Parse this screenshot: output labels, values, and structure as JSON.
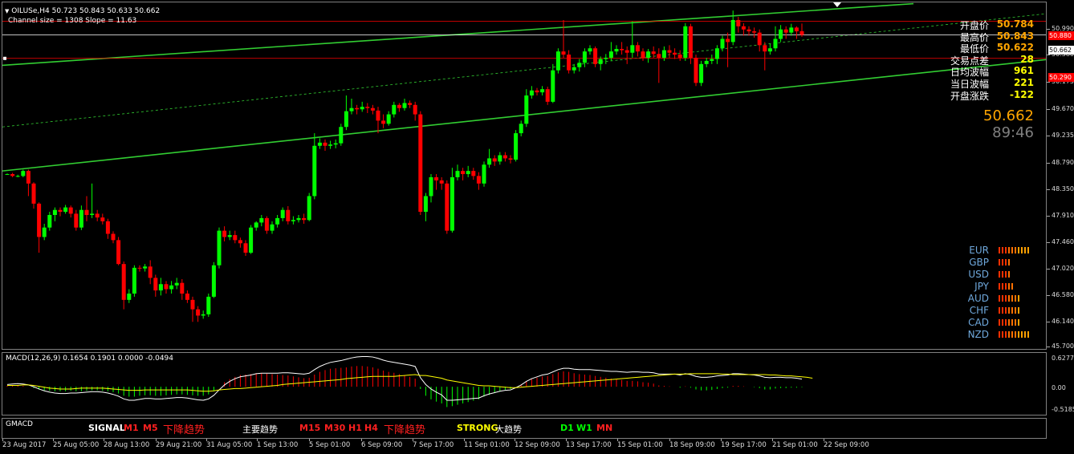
{
  "header": {
    "symbol_line": "OILUSe,H4  50.723 50.843 50.633 50.662",
    "channel_line": "Channel size = 1308 Slope = 11.63"
  },
  "info_panel": {
    "rows": [
      {
        "label": "开盘价",
        "value": "50.784",
        "color": "#ffa500"
      },
      {
        "label": "最高价",
        "value": "50.843",
        "color": "#ffa500"
      },
      {
        "label": "最低价",
        "value": "50.622",
        "color": "#ffa500"
      },
      {
        "label": "交易点差",
        "value": "28",
        "color": "#ffff00"
      },
      {
        "label": "日均波幅",
        "value": "961",
        "color": "#ffff00"
      },
      {
        "label": "当日波幅",
        "value": "221",
        "color": "#ffff00"
      },
      {
        "label": "开盘涨跌",
        "value": "-122",
        "color": "#ffff00"
      }
    ],
    "price_big": "50.662",
    "timer": "89:46"
  },
  "currency_strength": [
    {
      "name": "EUR",
      "bars": 10
    },
    {
      "name": "GBP",
      "bars": 4
    },
    {
      "name": "USD",
      "bars": 4
    },
    {
      "name": "JPY",
      "bars": 5
    },
    {
      "name": "AUD",
      "bars": 7
    },
    {
      "name": "CHF",
      "bars": 7
    },
    {
      "name": "CAD",
      "bars": 7
    },
    {
      "name": "NZD",
      "bars": 10
    }
  ],
  "y_axis": [
    "50.990",
    "50.580",
    "50.175",
    "49.670",
    "49.235",
    "48.790",
    "48.350",
    "47.910",
    "47.460",
    "47.020",
    "46.580",
    "46.140",
    "45.700"
  ],
  "price_tags": [
    {
      "label": "50.880",
      "bg": "#ff0000",
      "fg": "#fff"
    },
    {
      "label": "50.662",
      "bg": "#ffffff",
      "fg": "#000"
    },
    {
      "label": "50.290",
      "bg": "#ff0000",
      "fg": "#fff"
    }
  ],
  "macd": {
    "title": "MACD(12,26,9) 0.1654 0.1901 0.0000 -0.0494",
    "y_axis": [
      "0.6277",
      "0.00",
      "-0.5185"
    ]
  },
  "gmacd": {
    "title": "GMACD",
    "signal_label": "SIGNAL",
    "m1": "M1",
    "m5": "M5",
    "trend_short": "下降趋势",
    "main_trend": "主要趋势",
    "m15": "M15",
    "m30": "M30",
    "h1": "H1",
    "h4": "H4",
    "trend_mid": "下降趋势",
    "strong": "STRONG",
    "big_trend": "大趋势",
    "d1": "D1",
    "w1": "W1",
    "mn": "MN"
  },
  "x_axis": [
    "23 Aug 2017",
    "25 Aug 05:00",
    "28 Aug 13:00",
    "29 Aug 21:00",
    "31 Aug 05:00",
    "1 Sep 13:00",
    "5 Sep 01:00",
    "6 Sep 09:00",
    "7 Sep 17:00",
    "11 Sep 01:00",
    "12 Sep 09:00",
    "13 Sep 17:00",
    "15 Sep 01:00",
    "18 Sep 09:00",
    "19 Sep 17:00",
    "21 Sep 01:00",
    "22 Sep 09:00"
  ],
  "colors": {
    "bull": "#00ff00",
    "bear": "#ff0000",
    "channel": "#32cd32",
    "hist_pos": "#ff0000",
    "hist_neg": "#00ff00",
    "macd_main": "#ffffff",
    "macd_signal": "#ffff00"
  },
  "candles": [
    [
      48.45,
      48.45,
      48.44,
      48.46
    ],
    [
      48.45,
      48.42,
      48.4,
      48.47
    ],
    [
      48.42,
      48.42,
      48.4,
      48.44
    ],
    [
      48.42,
      48.5,
      48.4,
      48.52
    ],
    [
      48.5,
      48.3,
      48.1,
      48.52
    ],
    [
      48.3,
      47.98,
      47.9,
      48.32
    ],
    [
      47.98,
      47.45,
      47.2,
      48.0
    ],
    [
      47.45,
      47.6,
      47.4,
      47.66
    ],
    [
      47.6,
      47.8,
      47.55,
      47.85
    ],
    [
      47.8,
      47.88,
      47.7,
      47.92
    ],
    [
      47.88,
      47.85,
      47.78,
      47.92
    ],
    [
      47.85,
      47.92,
      47.82,
      47.96
    ],
    [
      47.92,
      47.82,
      47.76,
      47.95
    ],
    [
      47.82,
      47.6,
      47.55,
      47.88
    ],
    [
      47.6,
      47.88,
      47.56,
      47.95
    ],
    [
      47.88,
      47.8,
      47.7,
      48.1
    ],
    [
      47.8,
      47.82,
      47.75,
      48.3
    ],
    [
      47.82,
      47.76,
      47.7,
      47.88
    ],
    [
      47.76,
      47.7,
      47.65,
      47.82
    ],
    [
      47.7,
      47.5,
      47.42,
      47.74
    ],
    [
      47.5,
      47.4,
      47.35,
      47.54
    ],
    [
      47.4,
      47.02,
      47.0,
      47.45
    ],
    [
      47.02,
      46.45,
      46.3,
      47.06
    ],
    [
      46.45,
      46.55,
      46.4,
      46.62
    ],
    [
      46.55,
      46.96,
      46.5,
      47.0
    ],
    [
      46.96,
      46.95,
      46.9,
      47.0
    ],
    [
      46.95,
      46.98,
      46.9,
      47.02
    ],
    [
      46.98,
      46.8,
      46.7,
      47.08
    ],
    [
      46.8,
      46.6,
      46.5,
      46.85
    ],
    [
      46.6,
      46.7,
      46.52,
      46.8
    ],
    [
      46.7,
      46.62,
      46.55,
      46.75
    ],
    [
      46.62,
      46.68,
      46.55,
      46.75
    ],
    [
      46.68,
      46.72,
      46.62,
      46.8
    ],
    [
      46.72,
      46.55,
      46.45,
      46.78
    ],
    [
      46.55,
      46.45,
      46.4,
      46.6
    ],
    [
      46.45,
      46.3,
      46.1,
      46.5
    ],
    [
      46.3,
      46.2,
      46.1,
      46.35
    ],
    [
      46.2,
      46.22,
      46.15,
      46.28
    ],
    [
      46.22,
      46.5,
      46.18,
      46.55
    ],
    [
      46.5,
      47.0,
      46.48,
      47.05
    ],
    [
      47.0,
      47.55,
      46.95,
      47.6
    ],
    [
      47.55,
      47.45,
      47.38,
      47.62
    ],
    [
      47.45,
      47.48,
      47.4,
      47.55
    ],
    [
      47.48,
      47.4,
      47.35,
      47.55
    ],
    [
      47.4,
      47.35,
      47.28,
      47.44
    ],
    [
      47.35,
      47.2,
      47.15,
      47.4
    ],
    [
      47.2,
      47.6,
      47.18,
      47.64
    ],
    [
      47.6,
      47.68,
      47.55,
      47.7
    ],
    [
      47.68,
      47.75,
      47.62,
      47.8
    ],
    [
      47.75,
      47.55,
      47.5,
      47.78
    ],
    [
      47.55,
      47.65,
      47.5,
      47.7
    ],
    [
      47.65,
      47.75,
      47.6,
      47.8
    ],
    [
      47.75,
      47.88,
      47.7,
      47.92
    ],
    [
      47.88,
      47.7,
      47.65,
      47.94
    ],
    [
      47.7,
      47.72,
      47.65,
      47.78
    ],
    [
      47.72,
      47.75,
      47.68,
      47.8
    ],
    [
      47.75,
      47.72,
      47.66,
      47.82
    ],
    [
      47.72,
      48.1,
      47.7,
      48.15
    ],
    [
      48.1,
      48.9,
      48.05,
      49.1
    ],
    [
      48.9,
      48.95,
      48.85,
      49.02
    ],
    [
      48.95,
      48.9,
      48.82,
      49.0
    ],
    [
      48.9,
      48.92,
      48.85,
      48.98
    ],
    [
      48.92,
      48.94,
      48.86,
      49.0
    ],
    [
      48.94,
      49.2,
      48.9,
      49.25
    ],
    [
      49.2,
      49.45,
      49.15,
      49.7
    ],
    [
      49.45,
      49.5,
      49.4,
      49.65
    ],
    [
      49.5,
      49.48,
      49.4,
      49.55
    ],
    [
      49.48,
      49.52,
      49.44,
      49.6
    ],
    [
      49.52,
      49.5,
      49.42,
      49.58
    ],
    [
      49.5,
      49.46,
      49.4,
      49.55
    ],
    [
      49.46,
      49.3,
      49.1,
      49.52
    ],
    [
      49.3,
      49.25,
      49.18,
      49.4
    ],
    [
      49.25,
      49.4,
      49.22,
      49.45
    ],
    [
      49.4,
      49.55,
      49.35,
      49.6
    ],
    [
      49.55,
      49.5,
      49.44,
      49.58
    ],
    [
      49.5,
      49.58,
      49.46,
      49.65
    ],
    [
      49.58,
      49.55,
      49.5,
      49.62
    ],
    [
      49.55,
      49.4,
      49.3,
      49.6
    ],
    [
      49.4,
      47.85,
      47.8,
      49.45
    ],
    [
      47.85,
      48.1,
      47.7,
      48.15
    ],
    [
      48.1,
      48.4,
      48.0,
      48.45
    ],
    [
      48.4,
      48.35,
      48.2,
      48.45
    ],
    [
      48.35,
      48.3,
      48.2,
      48.4
    ],
    [
      48.3,
      47.55,
      47.5,
      48.35
    ],
    [
      47.55,
      48.4,
      47.52,
      48.55
    ],
    [
      48.4,
      48.5,
      48.35,
      48.6
    ],
    [
      48.5,
      48.45,
      48.35,
      48.55
    ],
    [
      48.45,
      48.5,
      48.4,
      48.58
    ],
    [
      48.5,
      48.42,
      48.36,
      48.55
    ],
    [
      48.42,
      48.3,
      48.2,
      48.48
    ],
    [
      48.3,
      48.6,
      48.25,
      48.65
    ],
    [
      48.6,
      48.7,
      48.55,
      48.85
    ],
    [
      48.7,
      48.65,
      48.58,
      48.75
    ],
    [
      48.65,
      48.75,
      48.6,
      48.8
    ],
    [
      48.75,
      48.7,
      48.65,
      48.8
    ],
    [
      48.7,
      48.68,
      48.62,
      48.75
    ],
    [
      48.68,
      49.1,
      48.65,
      49.15
    ],
    [
      49.1,
      49.25,
      49.05,
      49.3
    ],
    [
      49.25,
      49.7,
      49.2,
      49.8
    ],
    [
      49.7,
      49.78,
      49.65,
      49.85
    ],
    [
      49.78,
      49.75,
      49.7,
      49.82
    ],
    [
      49.75,
      49.8,
      49.7,
      49.85
    ],
    [
      49.8,
      49.6,
      49.55,
      49.84
    ],
    [
      49.6,
      50.1,
      49.58,
      50.2
    ],
    [
      50.1,
      50.4,
      50.05,
      50.45
    ],
    [
      50.4,
      50.35,
      50.3,
      50.9
    ],
    [
      50.35,
      50.1,
      50.05,
      50.42
    ],
    [
      50.1,
      50.15,
      50.05,
      50.2
    ],
    [
      50.15,
      50.22,
      50.08,
      50.28
    ],
    [
      50.22,
      50.4,
      50.15,
      50.45
    ],
    [
      50.4,
      50.45,
      50.35,
      50.5
    ],
    [
      50.45,
      50.2,
      50.15,
      50.48
    ],
    [
      50.2,
      50.28,
      50.1,
      50.32
    ],
    [
      50.28,
      50.3,
      50.2,
      50.36
    ],
    [
      50.3,
      50.4,
      50.25,
      50.55
    ],
    [
      50.4,
      50.44,
      50.35,
      50.5
    ],
    [
      50.44,
      50.42,
      50.35,
      50.55
    ],
    [
      50.42,
      50.38,
      50.2,
      50.48
    ],
    [
      50.38,
      50.5,
      50.3,
      50.88
    ],
    [
      50.5,
      50.4,
      50.32,
      50.55
    ],
    [
      50.4,
      50.3,
      50.25,
      50.45
    ],
    [
      50.3,
      50.4,
      50.22,
      50.44
    ],
    [
      50.4,
      50.36,
      50.3,
      50.48
    ],
    [
      50.36,
      50.3,
      49.9,
      50.45
    ],
    [
      50.3,
      50.42,
      50.25,
      50.48
    ],
    [
      50.42,
      50.38,
      50.3,
      50.5
    ],
    [
      50.38,
      50.35,
      50.28,
      50.45
    ],
    [
      50.35,
      50.3,
      50.25,
      50.42
    ],
    [
      50.3,
      50.8,
      50.25,
      50.85
    ],
    [
      50.8,
      50.3,
      50.2,
      50.84
    ],
    [
      50.3,
      49.9,
      49.85,
      50.35
    ],
    [
      49.9,
      50.2,
      49.85,
      50.25
    ],
    [
      50.2,
      50.25,
      50.15,
      50.3
    ],
    [
      50.25,
      50.28,
      50.2,
      50.35
    ],
    [
      50.28,
      50.45,
      50.2,
      50.5
    ],
    [
      50.45,
      50.6,
      50.4,
      50.65
    ],
    [
      50.6,
      50.55,
      50.15,
      50.7
    ],
    [
      50.55,
      50.9,
      50.5,
      51.05
    ],
    [
      50.9,
      50.8,
      50.7,
      50.95
    ],
    [
      50.8,
      50.75,
      50.65,
      50.85
    ],
    [
      50.75,
      50.72,
      50.65,
      50.8
    ],
    [
      50.72,
      50.7,
      50.62,
      50.78
    ],
    [
      50.7,
      50.5,
      50.4,
      50.75
    ],
    [
      50.5,
      50.4,
      50.1,
      50.55
    ],
    [
      50.4,
      50.45,
      50.35,
      50.52
    ],
    [
      50.45,
      50.6,
      50.4,
      50.8
    ],
    [
      50.6,
      50.75,
      50.55,
      50.82
    ],
    [
      50.75,
      50.7,
      50.6,
      50.8
    ],
    [
      50.7,
      50.78,
      50.65,
      50.84
    ],
    [
      50.78,
      50.72,
      50.6,
      50.8
    ],
    [
      50.723,
      50.662,
      50.633,
      50.843
    ]
  ],
  "macd_series": {
    "hist": [
      0.02,
      0.03,
      0.04,
      0.02,
      0.0,
      -0.03,
      -0.06,
      -0.08,
      -0.09,
      -0.1,
      -0.1,
      -0.1,
      -0.09,
      -0.1,
      -0.1,
      -0.09,
      -0.08,
      -0.08,
      -0.09,
      -0.1,
      -0.12,
      -0.15,
      -0.2,
      -0.22,
      -0.22,
      -0.2,
      -0.19,
      -0.19,
      -0.2,
      -0.2,
      -0.19,
      -0.18,
      -0.17,
      -0.17,
      -0.18,
      -0.19,
      -0.2,
      -0.2,
      -0.17,
      -0.1,
      0.0,
      0.1,
      0.17,
      0.22,
      0.26,
      0.27,
      0.28,
      0.3,
      0.3,
      0.29,
      0.28,
      0.27,
      0.26,
      0.25,
      0.23,
      0.21,
      0.19,
      0.2,
      0.27,
      0.33,
      0.37,
      0.4,
      0.41,
      0.42,
      0.43,
      0.45,
      0.46,
      0.46,
      0.45,
      0.43,
      0.4,
      0.36,
      0.33,
      0.31,
      0.28,
      0.25,
      0.22,
      0.18,
      -0.05,
      -0.2,
      -0.28,
      -0.33,
      -0.37,
      -0.45,
      -0.43,
      -0.4,
      -0.37,
      -0.34,
      -0.31,
      -0.28,
      -0.22,
      -0.18,
      -0.14,
      -0.1,
      -0.07,
      -0.05,
      0.0,
      0.05,
      0.12,
      0.17,
      0.2,
      0.23,
      0.24,
      0.28,
      0.32,
      0.34,
      0.33,
      0.3,
      0.28,
      0.27,
      0.26,
      0.24,
      0.22,
      0.2,
      0.18,
      0.17,
      0.15,
      0.13,
      0.13,
      0.12,
      0.1,
      0.09,
      0.07,
      0.03,
      0.02,
      0.01,
      0.0,
      -0.02,
      0.01,
      -0.02,
      -0.06,
      -0.08,
      -0.08,
      -0.07,
      -0.05,
      -0.03,
      -0.02,
      0.02,
      0.02,
      0.01,
      0.0,
      -0.01,
      -0.03,
      -0.06,
      -0.06,
      -0.04,
      -0.03,
      -0.03,
      -0.02,
      -0.02,
      -0.01
    ],
    "main": [
      0.05,
      0.06,
      0.07,
      0.06,
      0.04,
      0.0,
      -0.05,
      -0.09,
      -0.12,
      -0.14,
      -0.15,
      -0.15,
      -0.14,
      -0.14,
      -0.13,
      -0.12,
      -0.11,
      -0.11,
      -0.12,
      -0.14,
      -0.17,
      -0.21,
      -0.27,
      -0.3,
      -0.3,
      -0.28,
      -0.26,
      -0.26,
      -0.27,
      -0.27,
      -0.26,
      -0.25,
      -0.24,
      -0.24,
      -0.25,
      -0.27,
      -0.29,
      -0.3,
      -0.27,
      -0.19,
      -0.07,
      0.04,
      0.12,
      0.18,
      0.22,
      0.24,
      0.26,
      0.29,
      0.3,
      0.3,
      0.3,
      0.3,
      0.31,
      0.31,
      0.3,
      0.29,
      0.28,
      0.3,
      0.38,
      0.45,
      0.5,
      0.54,
      0.56,
      0.58,
      0.61,
      0.64,
      0.66,
      0.67,
      0.67,
      0.66,
      0.63,
      0.59,
      0.56,
      0.54,
      0.52,
      0.5,
      0.48,
      0.45,
      0.2,
      0.05,
      -0.05,
      -0.12,
      -0.18,
      -0.3,
      -0.3,
      -0.29,
      -0.28,
      -0.27,
      -0.26,
      -0.25,
      -0.2,
      -0.16,
      -0.13,
      -0.1,
      -0.08,
      -0.07,
      -0.02,
      0.04,
      0.12,
      0.18,
      0.22,
      0.26,
      0.28,
      0.33,
      0.38,
      0.41,
      0.41,
      0.39,
      0.38,
      0.38,
      0.38,
      0.37,
      0.36,
      0.35,
      0.34,
      0.34,
      0.33,
      0.32,
      0.33,
      0.33,
      0.32,
      0.32,
      0.31,
      0.28,
      0.28,
      0.28,
      0.28,
      0.26,
      0.29,
      0.27,
      0.23,
      0.21,
      0.21,
      0.22,
      0.24,
      0.25,
      0.26,
      0.29,
      0.29,
      0.28,
      0.27,
      0.26,
      0.24,
      0.21,
      0.2,
      0.21,
      0.21,
      0.2,
      0.2,
      0.19,
      0.17
    ],
    "signal": [
      0.03,
      0.03,
      0.03,
      0.04,
      0.04,
      0.03,
      0.01,
      -0.01,
      -0.03,
      -0.04,
      -0.05,
      -0.05,
      -0.05,
      -0.04,
      -0.03,
      -0.03,
      -0.03,
      -0.03,
      -0.03,
      -0.04,
      -0.05,
      -0.06,
      -0.07,
      -0.08,
      -0.08,
      -0.08,
      -0.07,
      -0.07,
      -0.07,
      -0.07,
      -0.07,
      -0.07,
      -0.07,
      -0.07,
      -0.07,
      -0.08,
      -0.09,
      -0.1,
      -0.1,
      -0.09,
      -0.07,
      -0.06,
      -0.05,
      -0.04,
      -0.04,
      -0.03,
      -0.02,
      -0.01,
      0.0,
      0.01,
      0.02,
      0.03,
      0.05,
      0.06,
      0.07,
      0.08,
      0.09,
      0.1,
      0.11,
      0.12,
      0.13,
      0.14,
      0.15,
      0.16,
      0.18,
      0.19,
      0.2,
      0.21,
      0.22,
      0.23,
      0.23,
      0.23,
      0.23,
      0.23,
      0.24,
      0.25,
      0.26,
      0.27,
      0.25,
      0.25,
      0.23,
      0.21,
      0.19,
      0.15,
      0.13,
      0.11,
      0.09,
      0.07,
      0.05,
      0.03,
      0.02,
      0.02,
      0.01,
      0.0,
      -0.01,
      -0.02,
      -0.02,
      -0.01,
      0.0,
      0.01,
      0.02,
      0.03,
      0.04,
      0.05,
      0.06,
      0.07,
      0.08,
      0.09,
      0.1,
      0.11,
      0.12,
      0.13,
      0.14,
      0.15,
      0.16,
      0.17,
      0.18,
      0.19,
      0.2,
      0.21,
      0.22,
      0.23,
      0.24,
      0.25,
      0.26,
      0.27,
      0.28,
      0.28,
      0.28,
      0.29,
      0.29,
      0.29,
      0.29,
      0.29,
      0.29,
      0.28,
      0.28,
      0.27,
      0.27,
      0.27,
      0.27,
      0.27,
      0.27,
      0.27,
      0.26,
      0.26,
      0.25,
      0.24,
      0.24,
      0.23,
      0.22,
      0.21,
      0.19
    ]
  }
}
